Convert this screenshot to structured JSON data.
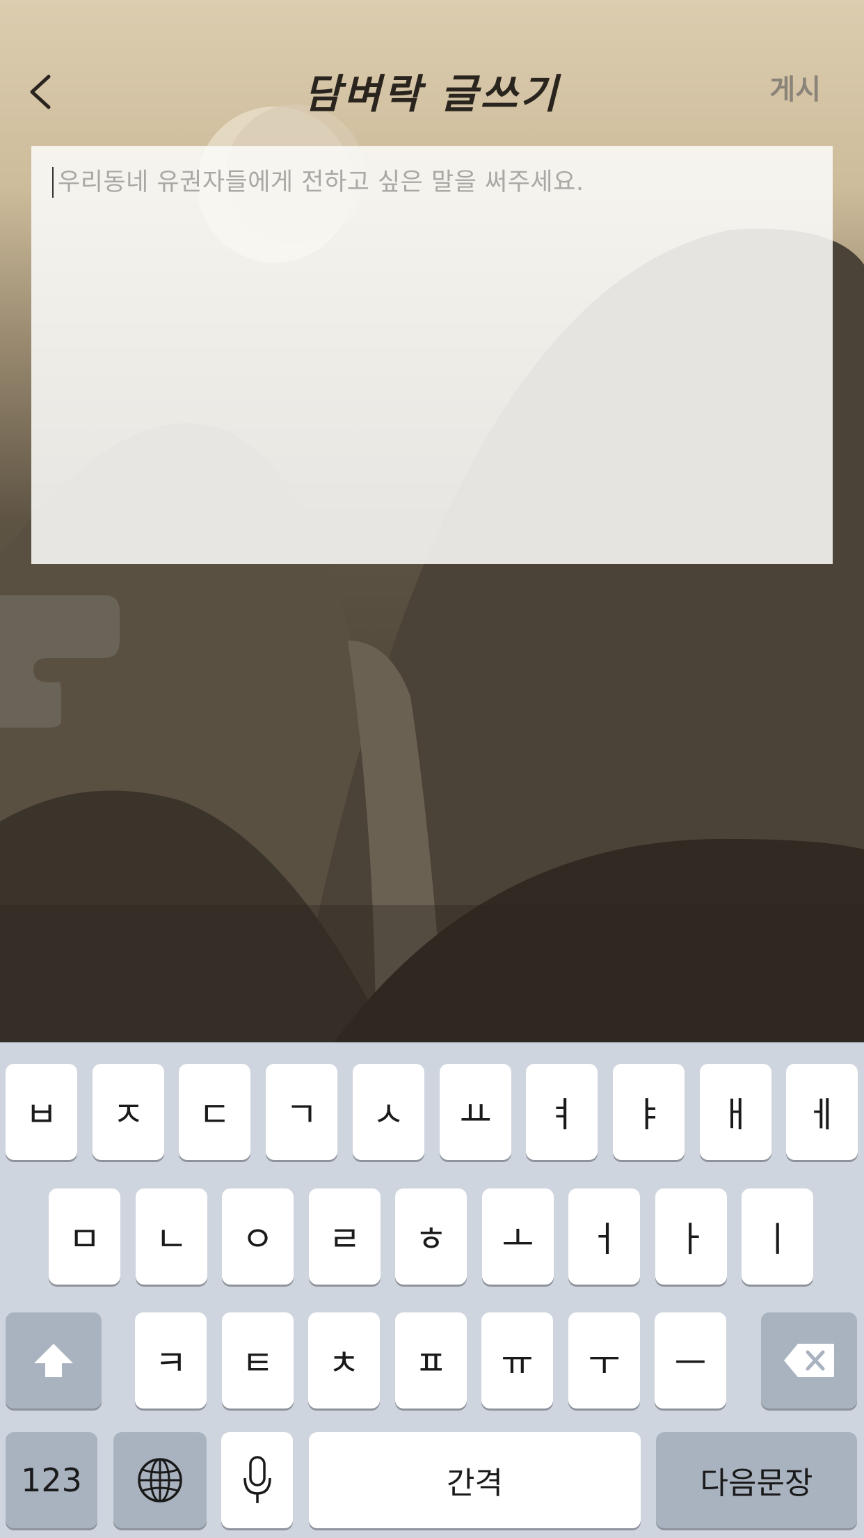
{
  "header": {
    "title": "담벼락 글쓰기",
    "post_label": "게시",
    "back_icon": "chevron-left-icon"
  },
  "editor": {
    "placeholder": "우리동네 유권자들에게 전하고 싶은 말을 써주세요."
  },
  "keyboard": {
    "row1": [
      "ㅂ",
      "ㅈ",
      "ㄷ",
      "ㄱ",
      "ㅅ",
      "ㅛ",
      "ㅕ",
      "ㅑ",
      "ㅐ",
      "ㅔ"
    ],
    "row2": [
      "ㅁ",
      "ㄴ",
      "ㅇ",
      "ㄹ",
      "ㅎ",
      "ㅗ",
      "ㅓ",
      "ㅏ",
      "ㅣ"
    ],
    "row3": [
      "ㅋ",
      "ㅌ",
      "ㅊ",
      "ㅍ",
      "ㅠ",
      "ㅜ",
      "ㅡ"
    ],
    "shift_icon": "shift-arrow-icon",
    "delete_icon": "backspace-icon",
    "numbers_label": "123",
    "globe_icon": "globe-icon",
    "mic_icon": "microphone-icon",
    "space_label": "간격",
    "return_label": "다음문장"
  },
  "colors": {
    "keyboard_bg": "#cfd5de",
    "key_bg": "#ffffff",
    "special_key_bg": "#a9b3c0",
    "title_text": "#2a241e",
    "post_text": "#8a8378"
  }
}
